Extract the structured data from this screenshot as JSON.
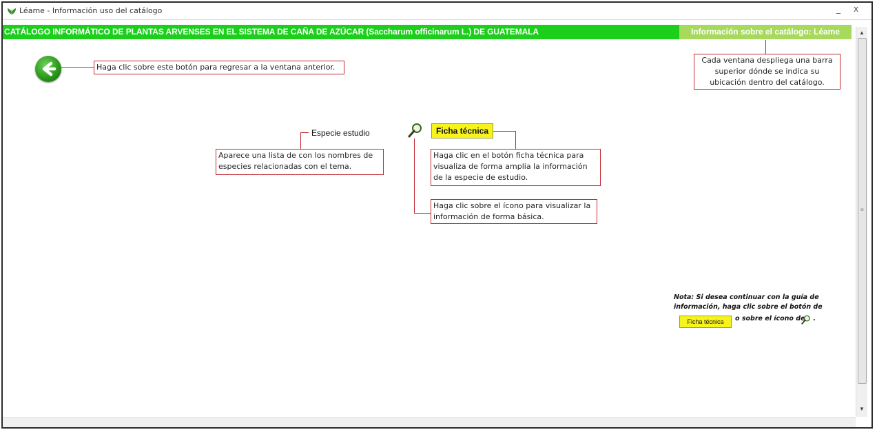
{
  "window": {
    "title": "Léame - Información uso del catálogo",
    "minimize_label": "_",
    "close_label": "x"
  },
  "header": {
    "main_title": "CATÁLOGO INFORMÁTICO DE PLANTAS ARVENSES EN EL SISTEMA DE CAÑA DE AZÚCAR (Saccharum officinarum L.) DE GUATEMALA",
    "section_title": "Información sobre el catálogo: Léame"
  },
  "callouts": {
    "back": "Haga clic sobre este botón para regresar a la ventana anterior.",
    "topbar": "Cada ventana despliega una barra superior dónde se indica su ubicación dentro del catálogo.",
    "species_list": "Aparece una lista de con los nombres de especies relacionadas con el tema.",
    "ficha": "Haga clic en el botón ficha técnica para visualiza de forma amplia la información de la especie de estudio.",
    "icon": "Haga clic sobre el ícono para visualizar la información de forma básica."
  },
  "content": {
    "species_label": "Especie estudio",
    "ficha_button": "Ficha técnica"
  },
  "note": {
    "text_1": "Nota: Si desea continuar con la guía de información, haga clic sobre el botón de",
    "button_label": "Ficha técnica",
    "text_2": "o sobre el ícono de",
    "text_3": "."
  },
  "colors": {
    "header_green": "#1bcf1b",
    "section_green": "#a6d95c",
    "callout_border": "#c1272d",
    "button_yellow": "#f7f31c"
  },
  "icons": [
    "leaf-app-icon",
    "back-arrow-icon",
    "magnifier-icon"
  ]
}
